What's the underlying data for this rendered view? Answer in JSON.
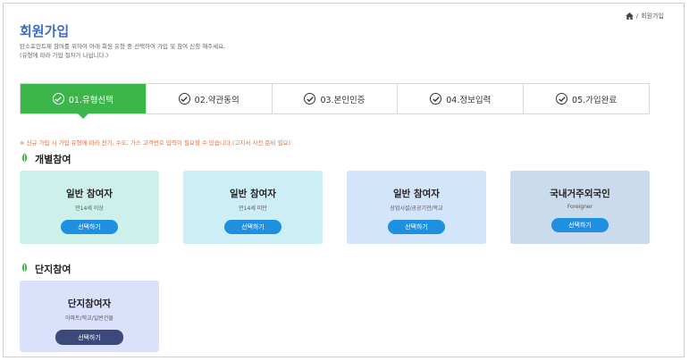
{
  "breadcrumb": {
    "label": "회원가입"
  },
  "page": {
    "title": "회원가입",
    "desc_line1": "탄소포인트제 참여를 위하여 아래 회원 유형 중 선택하여 가입 및 참여 신청 해주세요.",
    "desc_line2": "(유형에 따라 가입 절차가 나뉩니다.)"
  },
  "steps": [
    {
      "label": "01.유형선택",
      "active": true
    },
    {
      "label": "02.약관동의",
      "active": false
    },
    {
      "label": "03.본인인증",
      "active": false
    },
    {
      "label": "04.정보입력",
      "active": false
    },
    {
      "label": "05.가입완료",
      "active": false
    }
  ],
  "notice": "※ 신규 가입 시 가입 유형에 따라 전기, 수도, 가스 고객번호 입력이 필요할 수 있습니다.(고지서 사전 준비 필요)",
  "sections": {
    "individual": "개별참여",
    "complex": "단지참여"
  },
  "cards": [
    {
      "title": "일반 참여자",
      "sub": "만14세 이상",
      "button": "선택하기"
    },
    {
      "title": "일반 참여자",
      "sub": "만14세 미만",
      "button": "선택하기"
    },
    {
      "title": "일반 참여자",
      "sub": "상업시설/공공기관/학교",
      "button": "선택하기"
    },
    {
      "title": "국내거주외국인",
      "sub": "Foreigner",
      "button": "선택하기"
    },
    {
      "title": "단지참여자",
      "sub": "아파트/학교/일반건물",
      "button": "선택하기"
    }
  ],
  "colors": {
    "accent": "#3cb54a",
    "title": "#3b6fbf",
    "button": "#1f8fe0",
    "button_dark": "#3b4a7a",
    "notice": "#e8703a"
  },
  "icons": {
    "home": "home-icon",
    "step": "check-circle-icon",
    "section": "leaf-icon"
  }
}
